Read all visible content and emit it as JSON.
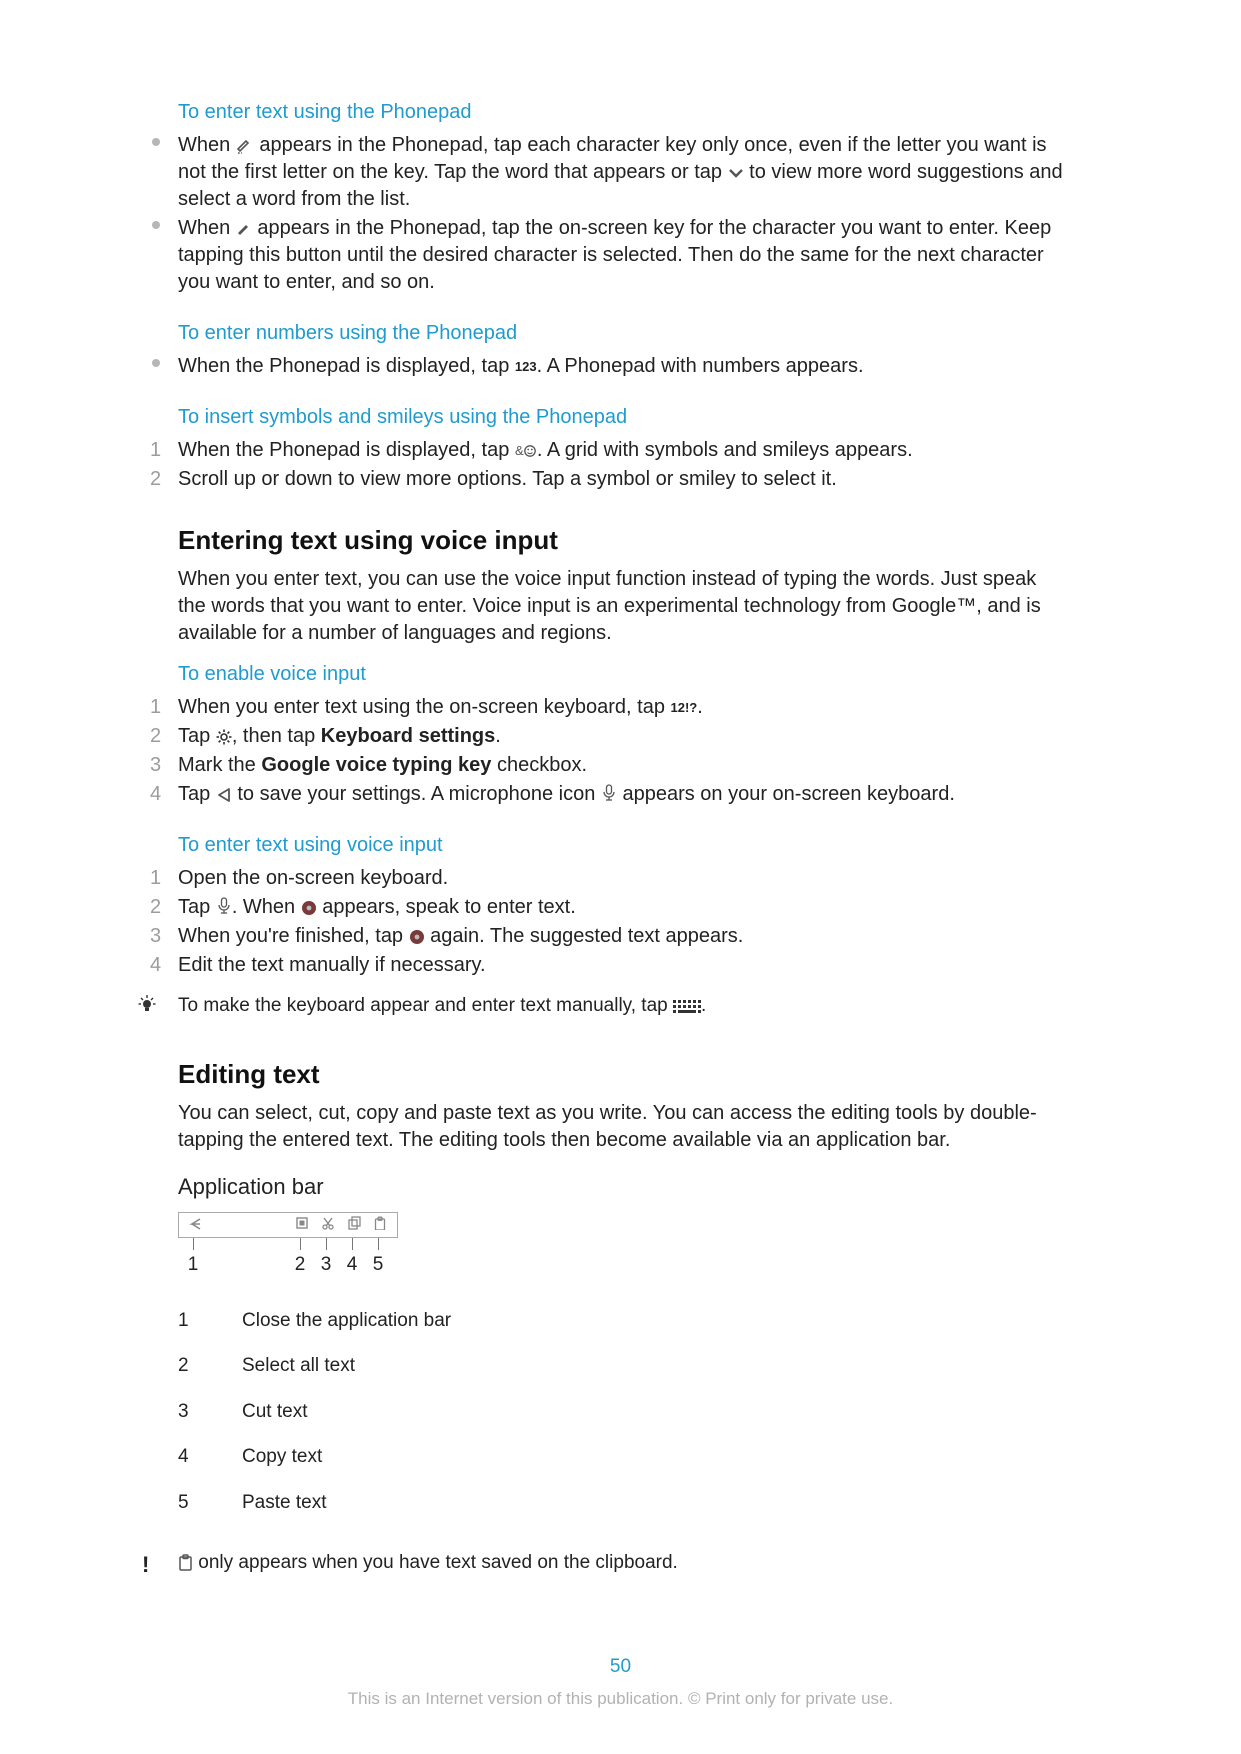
{
  "s1": {
    "title": "To enter text using the Phonepad",
    "b1a": "When ",
    "b1b": " appears in the Phonepad, tap each character key only once, even if the letter you want is not the first letter on the key. Tap the word that appears or tap ",
    "b1c": " to view more word suggestions and select a word from the list.",
    "b2a": "When ",
    "b2b": " appears in the Phonepad, tap the on-screen key for the character you want to enter. Keep tapping this button until the desired character is selected. Then do the same for the next character you want to enter, and so on."
  },
  "s2": {
    "title": "To enter numbers using the Phonepad",
    "b1a": "When the Phonepad is displayed, tap ",
    "num": "123",
    "b1b": ". A Phonepad with numbers appears."
  },
  "s3": {
    "title": "To insert symbols and smileys using the Phonepad",
    "i1a": "When the Phonepad is displayed, tap ",
    "i1b": ". A grid with symbols and smileys appears.",
    "i2": "Scroll up or down to view more options. Tap a symbol or smiley to select it."
  },
  "s4": {
    "title": "Entering text using voice input",
    "p": "When you enter text, you can use the voice input function instead of typing the words. Just speak the words that you want to enter. Voice input is an experimental technology from Google™, and is available for a number of languages and regions."
  },
  "s5": {
    "title": "To enable voice input",
    "i1a": "When you enter text using the on-screen keyboard, tap ",
    "tag": "12!?",
    "i1b": ".",
    "i2a": "Tap ",
    "i2b": ", then tap ",
    "i2bold": "Keyboard settings",
    "i2c": ".",
    "i3a": "Mark the ",
    "i3bold": "Google voice typing key",
    "i3b": " checkbox.",
    "i4a": "Tap ",
    "i4b": " to save your settings. A microphone icon ",
    "i4c": " appears on your on-screen keyboard."
  },
  "s6": {
    "title": "To enter text using voice input",
    "i1": "Open the on-screen keyboard.",
    "i2a": "Tap ",
    "i2b": ". When ",
    "i2c": " appears, speak to enter text.",
    "i3a": "When you're finished, tap ",
    "i3b": " again. The suggested text appears.",
    "i4": "Edit the text manually if necessary.",
    "tip_a": "To make the keyboard appear and enter text manually, tap ",
    "tip_b": "."
  },
  "s7": {
    "title": "Editing text",
    "p": "You can select, cut, copy and paste text as you write. You can access the editing tools by double-tapping the entered text. The editing tools then become available via an application bar."
  },
  "s8": {
    "title": "Application bar",
    "legend": [
      {
        "k": "1",
        "v": "Close the application bar"
      },
      {
        "k": "2",
        "v": "Select all text"
      },
      {
        "k": "3",
        "v": "Cut text"
      },
      {
        "k": "4",
        "v": "Copy text"
      },
      {
        "k": "5",
        "v": "Paste text"
      }
    ],
    "note_a": " only appears when you have text saved on the clipboard."
  },
  "page_number": "50",
  "footer": "This is an Internet version of this publication. © Print only for private use."
}
